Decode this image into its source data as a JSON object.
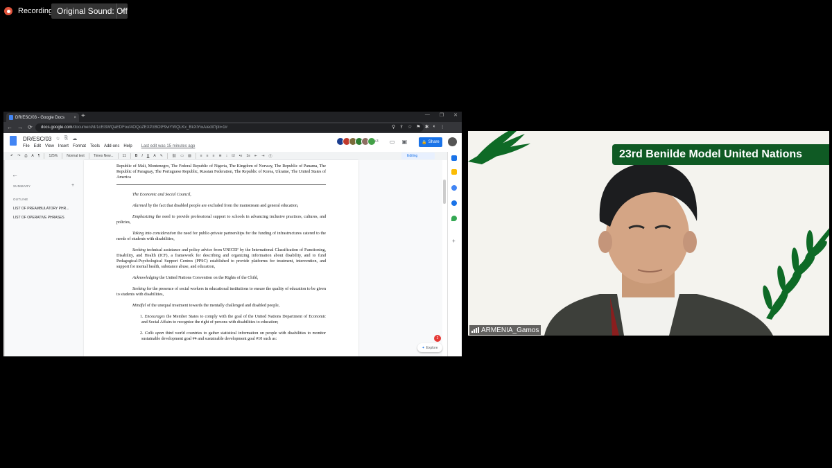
{
  "meeting": {
    "recording_label": "Recording",
    "original_sound_label": "Original Sound: Off",
    "caret": "▾"
  },
  "browser": {
    "tab_title": "DR/ESC/03 - Google Docs",
    "tab_close": "×",
    "new_tab": "+",
    "window_controls": [
      "—",
      "❐",
      "✕"
    ],
    "nav": [
      "←",
      "→",
      "⟳"
    ],
    "url_host": "docs.google.com",
    "url_path": "/document/d/1cEl3WQaEDFouf4OQoZEXPzBOtF9viYWQLKx_BkXlYwA/edit?pli=1#",
    "icons": [
      "⚲",
      "⇪",
      "☆",
      "⚑",
      "✱",
      "◐",
      "⋮"
    ]
  },
  "docs": {
    "title": "DR/ESC/03",
    "title_icons": [
      "☆",
      "⎘",
      "☁"
    ],
    "menus": [
      "File",
      "Edit",
      "View",
      "Insert",
      "Format",
      "Tools",
      "Add-ons",
      "Help"
    ],
    "last_edit": "Last edit was 15 minutes ago",
    "collaborators_more": "+3",
    "share_label": "Share",
    "share_icon": "🔒",
    "header_icons": [
      "▭",
      "▣"
    ],
    "toolbar": {
      "zoom": "125%",
      "style": "Normal text",
      "font": "Times New...",
      "size": "11",
      "bold": "B",
      "italic": "I",
      "underline": "U",
      "editing_label": "Editing"
    },
    "outline": {
      "back_icon": "←",
      "summary_label": "SUMMARY",
      "add_icon": "+",
      "outline_label": "OUTLINE",
      "items": [
        "LIST OF PREAMBULATORY PHR...",
        "LIST OF OPERATIVE PHRASES"
      ]
    },
    "explore_label": "Explore",
    "explore_badge": "2",
    "document": {
      "signatories": "Republic of Mali, Montenegro, The Federal Republic of Nigeria, The Kingdom of Norway, The Republic of Panama, The Republic of Paraguay, The Portuguese Republic, Russian Federation, The Republic of Korea, Ukraine, The United States of America",
      "committee": "The Economic and Social Council,",
      "clauses": [
        {
          "phrase": "Alarmed by",
          "text": " the fact that disabled people are excluded from the mainstream and general education,"
        },
        {
          "phrase": "Emphasizing",
          "text": " the need to provide professional support to schools in advancing inclusive practices, cultures, and policies,"
        },
        {
          "phrase": "Taking into consideration",
          "text": " the need for public-private partnerships for the funding of infrastructures catered to the needs of students with disabilities,"
        },
        {
          "phrase": "Seeking",
          "text": " technical assistance and policy advice from UNICEF by the International Classification of Functioning, Disability, and Health (ICF), a framework for describing and organizing information about disability, and to fund Pedagogical-Psychological Support Centres (PPSC) established to provide platforms for treatment, intervention, and support for mental health, substance abuse, and education,"
        },
        {
          "phrase": "Acknowledging",
          "text": " the United Nations Convention on the Rights of the Child,"
        },
        {
          "phrase": "Seeking",
          "text": " for the presence of social workers in educational institutions to ensure the quality of education to be given to students with disabilities,"
        },
        {
          "phrase": "Mindful",
          "text": " of the unequal treatment towards the mentally challenged and disabled people,"
        }
      ],
      "operatives": [
        {
          "num": "1.",
          "phrase": "Encourages",
          "text": " the Member States to comply with the goal of the United Nations Department of Economic and Social Affairs to recognize the right of persons with disabilities to education;"
        },
        {
          "num": "2.",
          "phrase": "Calls upon",
          "text": " third world countries to gather statistical information on people with disabilities to monitor sustainable development goal #4 and sustainable development goal #10 such as:"
        }
      ]
    }
  },
  "video": {
    "banner_text": "23rd Benilde Model United Nations",
    "participant_name": "ARMENIA_Gamos",
    "colors": {
      "banner": "#0f5a24",
      "leaf": "#0e6a26"
    }
  }
}
